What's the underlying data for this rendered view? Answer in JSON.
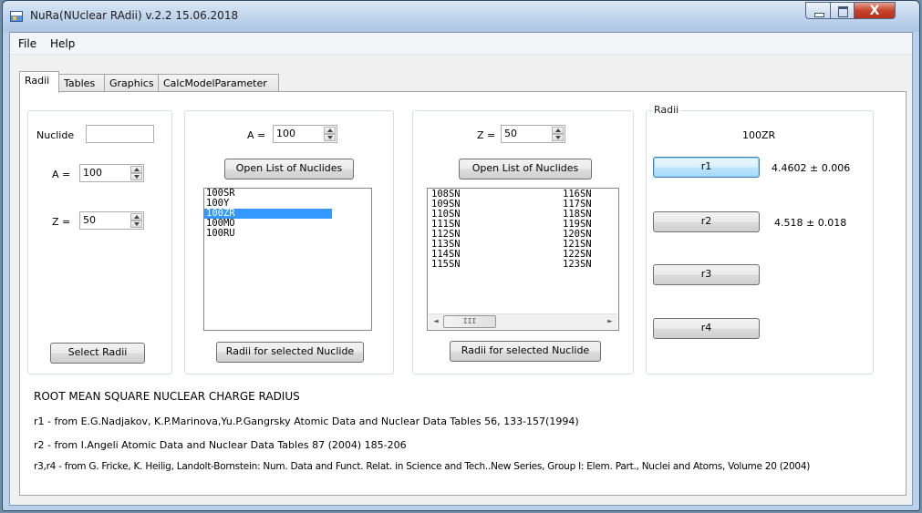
{
  "window": {
    "title": "NuRa(NUclear RAdii) v.2.2 15.06.2018",
    "close_glyph": "X"
  },
  "menu": [
    "File",
    "Help"
  ],
  "tabs": [
    "Radii",
    "Tables",
    "Graphics",
    "CalcModelParameter"
  ],
  "active_tab": "Radii",
  "panel1": {
    "nuclide_label": "Nuclide",
    "nuclide_value": "",
    "a_label": "A =",
    "a_value": "100",
    "z_label": "Z =",
    "z_value": "50",
    "select_button": "Select Radii"
  },
  "panel2": {
    "a_label": "A =",
    "a_value": "100",
    "open_button": "Open List of Nuclides",
    "list": [
      "100SR",
      "100Y",
      "100ZR",
      "100MO",
      "100RU"
    ],
    "selected_index": 2,
    "radii_button": "Radii for selected Nuclide"
  },
  "panel3": {
    "z_label": "Z =",
    "z_value": "50",
    "open_button": "Open List of Nuclides",
    "list_col1": [
      "108SN",
      "109SN",
      "110SN",
      "111SN",
      "112SN",
      "113SN",
      "114SN",
      "115SN"
    ],
    "list_col2": [
      "116SN",
      "117SN",
      "118SN",
      "119SN",
      "120SN",
      "121SN",
      "122SN",
      "123SN"
    ],
    "scroll_left": "◄",
    "scroll_thumb": "III",
    "scroll_right": "►",
    "radii_button": "Radii for selected Nuclide"
  },
  "radii_group": {
    "legend": "Radii",
    "nuclide": "100ZR",
    "buttons": [
      "r1",
      "r2",
      "r3",
      "r4"
    ],
    "values": [
      "4.4602 ± 0.006",
      "4.518 ± 0.018",
      "",
      ""
    ]
  },
  "references": {
    "heading": "ROOT MEAN SQUARE NUCLEAR CHARGE RADIUS",
    "r1": "r1 - from E.G.Nadjakov, K.P.Marinova,Yu.P.Gangrsky Atomic Data and Nuclear Data Tables 56, 133-157(1994)",
    "r2": "r2 - from I.Angeli Atomic Data and Nuclear Data Tables 87 (2004) 185-206",
    "r3r4": "r3,r4 - from G. Fricke, K. Heilig, Landolt-Bornstein: Num. Data and Funct. Relat. in Science and Tech..New Series, Group I: Elem. Part., Nuclei and Atoms, Volume 20 (2004)"
  }
}
